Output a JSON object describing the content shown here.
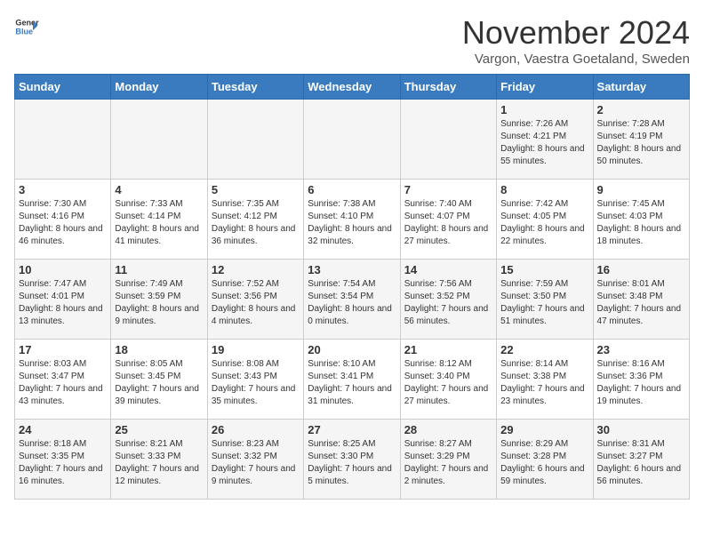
{
  "header": {
    "logo_general": "General",
    "logo_blue": "Blue",
    "month_title": "November 2024",
    "subtitle": "Vargon, Vaestra Goetaland, Sweden"
  },
  "days_of_week": [
    "Sunday",
    "Monday",
    "Tuesday",
    "Wednesday",
    "Thursday",
    "Friday",
    "Saturday"
  ],
  "weeks": [
    [
      {
        "day": "",
        "info": ""
      },
      {
        "day": "",
        "info": ""
      },
      {
        "day": "",
        "info": ""
      },
      {
        "day": "",
        "info": ""
      },
      {
        "day": "",
        "info": ""
      },
      {
        "day": "1",
        "info": "Sunrise: 7:26 AM\nSunset: 4:21 PM\nDaylight: 8 hours and 55 minutes."
      },
      {
        "day": "2",
        "info": "Sunrise: 7:28 AM\nSunset: 4:19 PM\nDaylight: 8 hours and 50 minutes."
      }
    ],
    [
      {
        "day": "3",
        "info": "Sunrise: 7:30 AM\nSunset: 4:16 PM\nDaylight: 8 hours and 46 minutes."
      },
      {
        "day": "4",
        "info": "Sunrise: 7:33 AM\nSunset: 4:14 PM\nDaylight: 8 hours and 41 minutes."
      },
      {
        "day": "5",
        "info": "Sunrise: 7:35 AM\nSunset: 4:12 PM\nDaylight: 8 hours and 36 minutes."
      },
      {
        "day": "6",
        "info": "Sunrise: 7:38 AM\nSunset: 4:10 PM\nDaylight: 8 hours and 32 minutes."
      },
      {
        "day": "7",
        "info": "Sunrise: 7:40 AM\nSunset: 4:07 PM\nDaylight: 8 hours and 27 minutes."
      },
      {
        "day": "8",
        "info": "Sunrise: 7:42 AM\nSunset: 4:05 PM\nDaylight: 8 hours and 22 minutes."
      },
      {
        "day": "9",
        "info": "Sunrise: 7:45 AM\nSunset: 4:03 PM\nDaylight: 8 hours and 18 minutes."
      }
    ],
    [
      {
        "day": "10",
        "info": "Sunrise: 7:47 AM\nSunset: 4:01 PM\nDaylight: 8 hours and 13 minutes."
      },
      {
        "day": "11",
        "info": "Sunrise: 7:49 AM\nSunset: 3:59 PM\nDaylight: 8 hours and 9 minutes."
      },
      {
        "day": "12",
        "info": "Sunrise: 7:52 AM\nSunset: 3:56 PM\nDaylight: 8 hours and 4 minutes."
      },
      {
        "day": "13",
        "info": "Sunrise: 7:54 AM\nSunset: 3:54 PM\nDaylight: 8 hours and 0 minutes."
      },
      {
        "day": "14",
        "info": "Sunrise: 7:56 AM\nSunset: 3:52 PM\nDaylight: 7 hours and 56 minutes."
      },
      {
        "day": "15",
        "info": "Sunrise: 7:59 AM\nSunset: 3:50 PM\nDaylight: 7 hours and 51 minutes."
      },
      {
        "day": "16",
        "info": "Sunrise: 8:01 AM\nSunset: 3:48 PM\nDaylight: 7 hours and 47 minutes."
      }
    ],
    [
      {
        "day": "17",
        "info": "Sunrise: 8:03 AM\nSunset: 3:47 PM\nDaylight: 7 hours and 43 minutes."
      },
      {
        "day": "18",
        "info": "Sunrise: 8:05 AM\nSunset: 3:45 PM\nDaylight: 7 hours and 39 minutes."
      },
      {
        "day": "19",
        "info": "Sunrise: 8:08 AM\nSunset: 3:43 PM\nDaylight: 7 hours and 35 minutes."
      },
      {
        "day": "20",
        "info": "Sunrise: 8:10 AM\nSunset: 3:41 PM\nDaylight: 7 hours and 31 minutes."
      },
      {
        "day": "21",
        "info": "Sunrise: 8:12 AM\nSunset: 3:40 PM\nDaylight: 7 hours and 27 minutes."
      },
      {
        "day": "22",
        "info": "Sunrise: 8:14 AM\nSunset: 3:38 PM\nDaylight: 7 hours and 23 minutes."
      },
      {
        "day": "23",
        "info": "Sunrise: 8:16 AM\nSunset: 3:36 PM\nDaylight: 7 hours and 19 minutes."
      }
    ],
    [
      {
        "day": "24",
        "info": "Sunrise: 8:18 AM\nSunset: 3:35 PM\nDaylight: 7 hours and 16 minutes."
      },
      {
        "day": "25",
        "info": "Sunrise: 8:21 AM\nSunset: 3:33 PM\nDaylight: 7 hours and 12 minutes."
      },
      {
        "day": "26",
        "info": "Sunrise: 8:23 AM\nSunset: 3:32 PM\nDaylight: 7 hours and 9 minutes."
      },
      {
        "day": "27",
        "info": "Sunrise: 8:25 AM\nSunset: 3:30 PM\nDaylight: 7 hours and 5 minutes."
      },
      {
        "day": "28",
        "info": "Sunrise: 8:27 AM\nSunset: 3:29 PM\nDaylight: 7 hours and 2 minutes."
      },
      {
        "day": "29",
        "info": "Sunrise: 8:29 AM\nSunset: 3:28 PM\nDaylight: 6 hours and 59 minutes."
      },
      {
        "day": "30",
        "info": "Sunrise: 8:31 AM\nSunset: 3:27 PM\nDaylight: 6 hours and 56 minutes."
      }
    ]
  ]
}
